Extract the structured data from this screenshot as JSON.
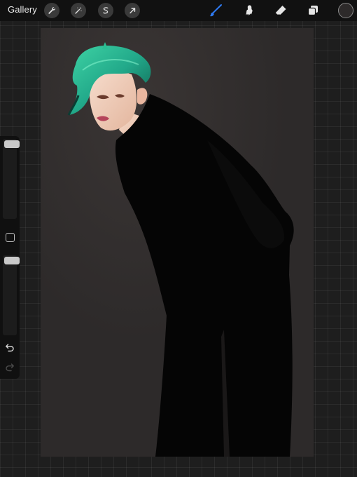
{
  "toolbar": {
    "gallery_label": "Gallery",
    "left_tools": [
      "wrench-icon",
      "magic-wand-icon",
      "selection-icon",
      "transform-arrow-icon"
    ],
    "right_tools": [
      "brush-icon",
      "smudge-icon",
      "eraser-icon",
      "layers-icon"
    ],
    "active_tool": "brush-icon",
    "accent_color": "#2f7cf6",
    "current_color": "#2d2a2a"
  },
  "sidebar": {
    "brush_size_level": 0.03,
    "opacity_level": 0.03,
    "tools": [
      "modify-button",
      "undo-icon",
      "redo-icon"
    ]
  },
  "canvas": {
    "background_color": "#2d2a2a",
    "artwork": "figure-with-green-hair-in-black-outfit"
  }
}
